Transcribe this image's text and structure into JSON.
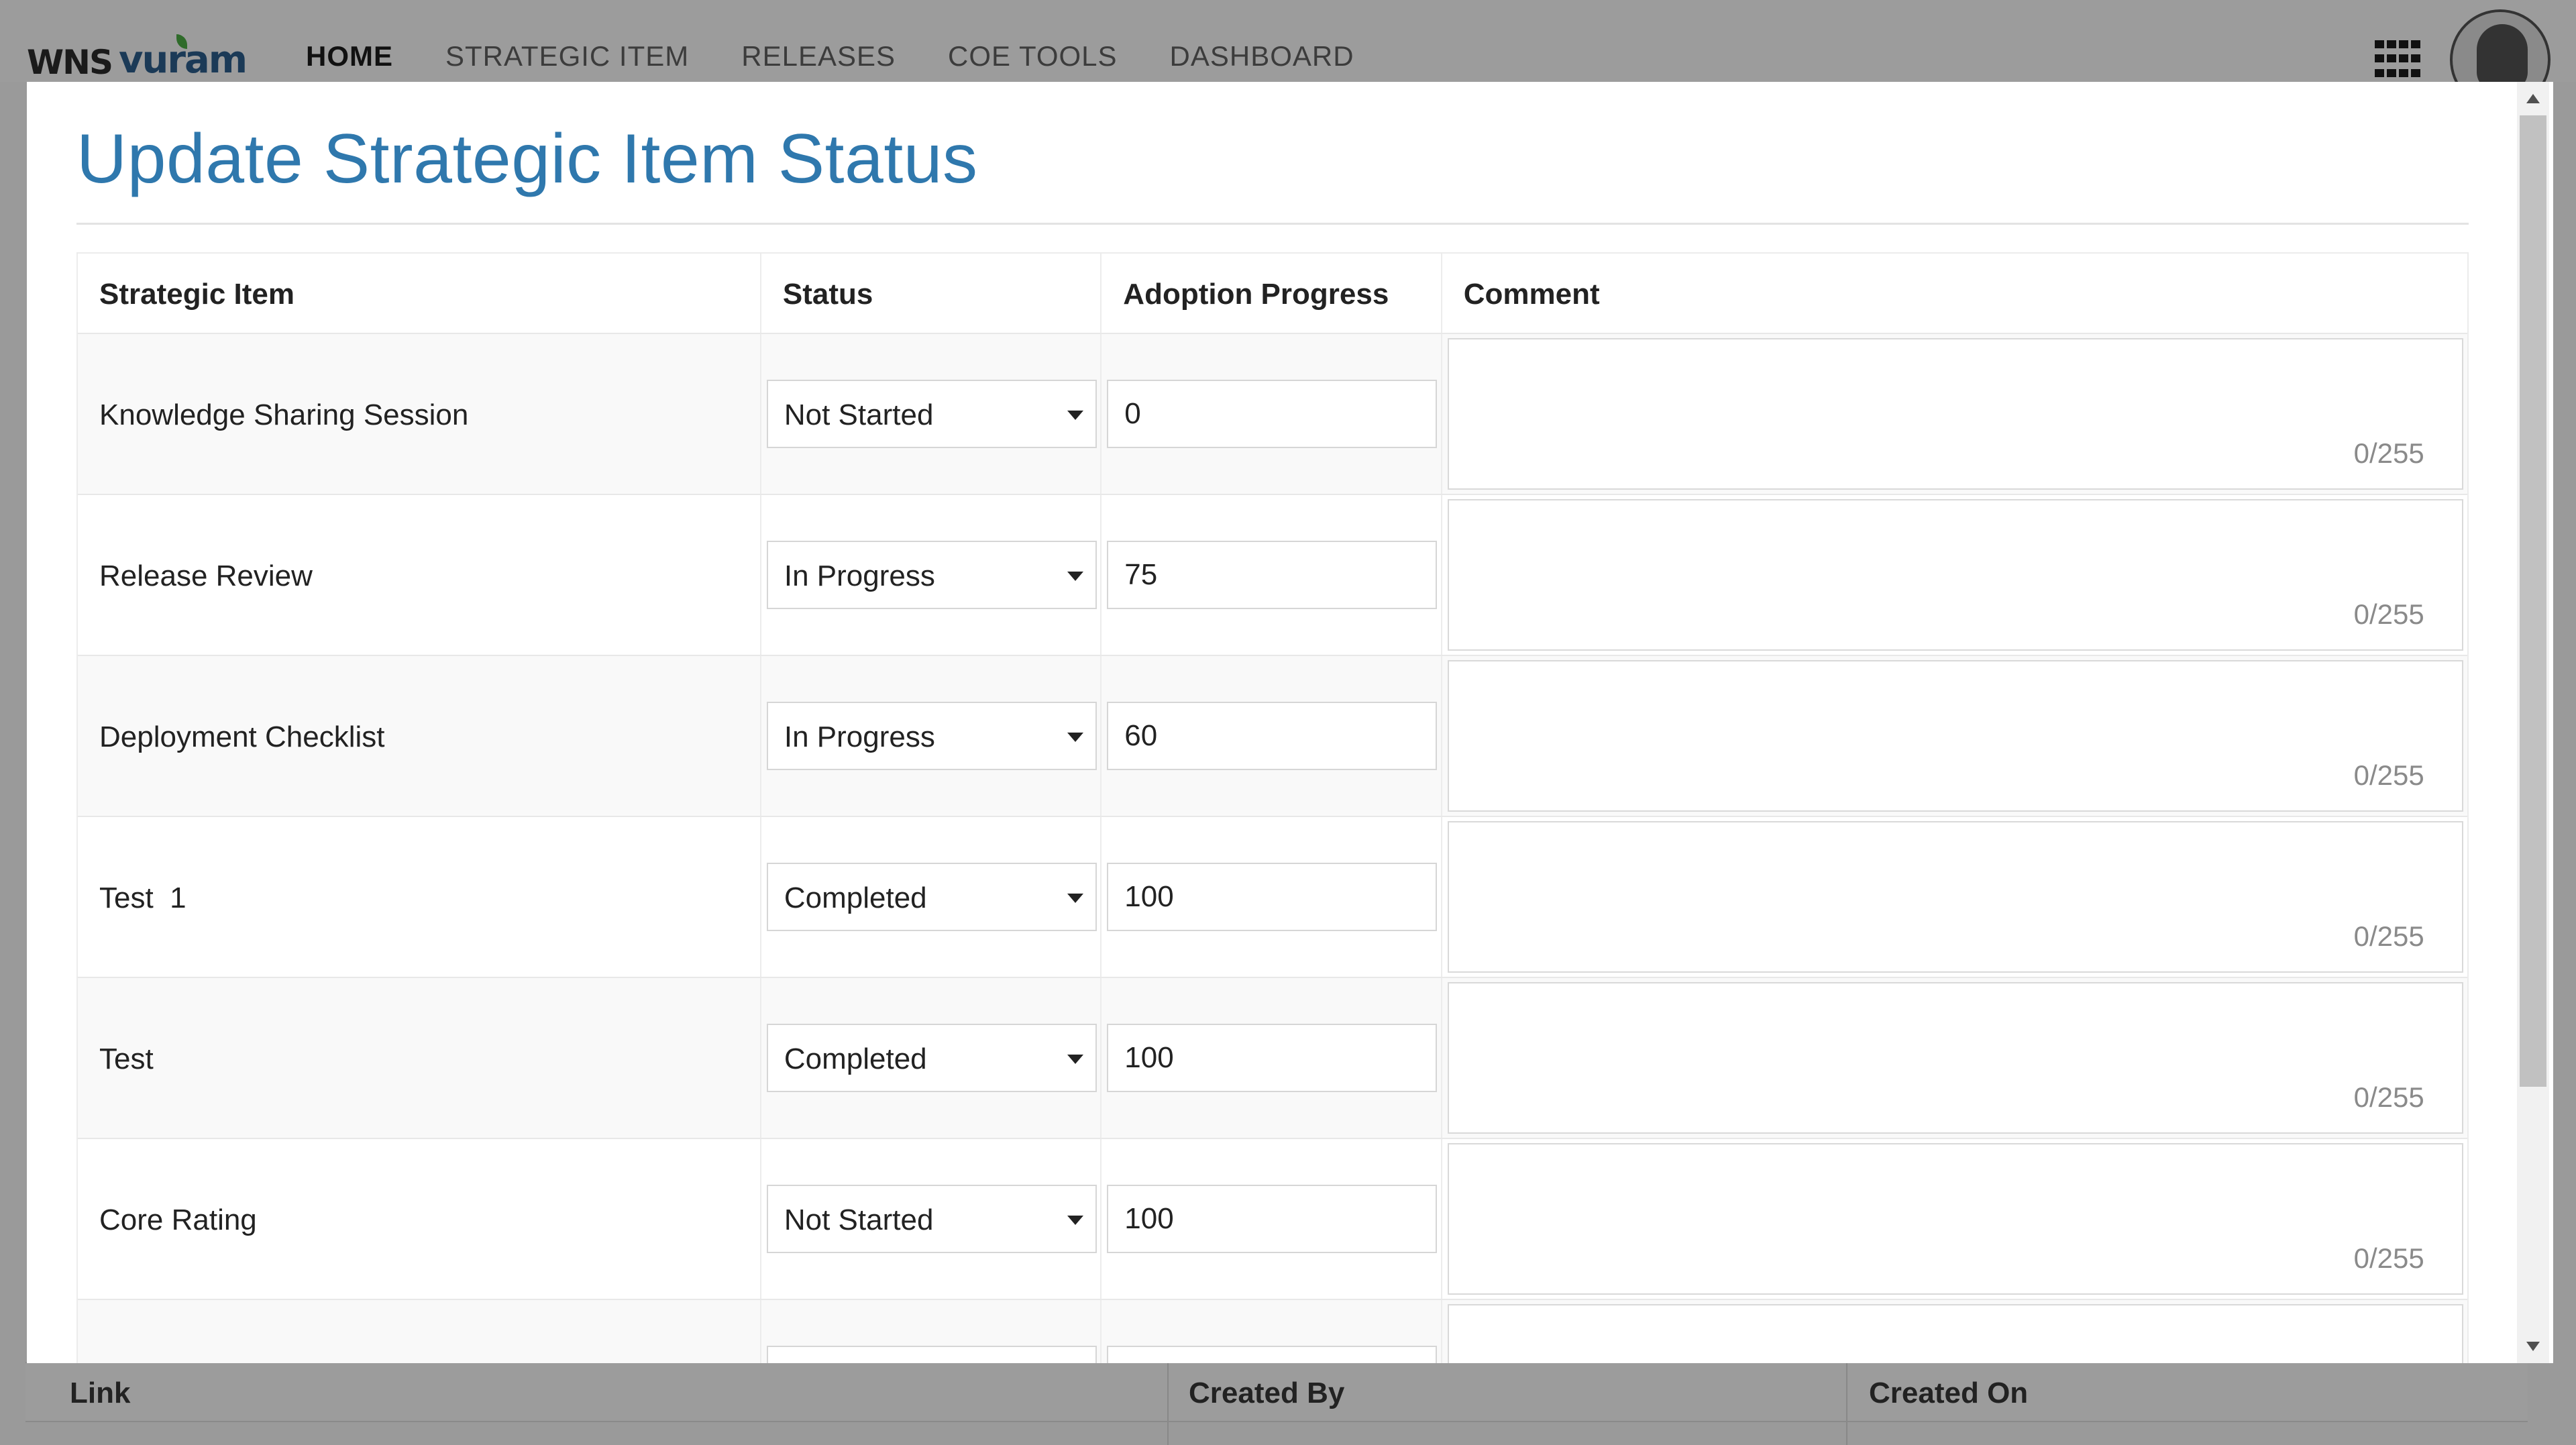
{
  "app": {
    "logo_wns": "WNS",
    "logo_vuram": "vuram",
    "nav": [
      "HOME",
      "STRATEGIC ITEM",
      "RELEASES",
      "COE TOOLS",
      "DASHBOARD"
    ],
    "active_nav": "HOME",
    "icons": {
      "apps": "grid-icon",
      "profile": "avatar"
    }
  },
  "background_table": {
    "columns": [
      "Link",
      "Created By",
      "Created On"
    ]
  },
  "modal": {
    "title": "Update Strategic Item Status",
    "columns": [
      "Strategic Item",
      "Status",
      "Adoption Progress",
      "Comment"
    ],
    "rows": [
      {
        "item": "Knowledge Sharing Session",
        "status": "Not Started",
        "progress": "0",
        "comment": "",
        "counter": "0/255"
      },
      {
        "item": "Release Review",
        "status": "In Progress",
        "progress": "75",
        "comment": "",
        "counter": "0/255"
      },
      {
        "item": "Deployment Checklist",
        "status": "In Progress",
        "progress": "60",
        "comment": "",
        "counter": "0/255"
      },
      {
        "item": "Test  1",
        "status": "Completed",
        "progress": "100",
        "comment": "",
        "counter": "0/255"
      },
      {
        "item": "Test",
        "status": "Completed",
        "progress": "100",
        "comment": "",
        "counter": "0/255"
      },
      {
        "item": "Core Rating",
        "status": "Not Started",
        "progress": "100",
        "comment": "",
        "counter": "0/255"
      }
    ]
  },
  "colors": {
    "title": "#2f78ad",
    "overlay": "#9a9a9a"
  }
}
